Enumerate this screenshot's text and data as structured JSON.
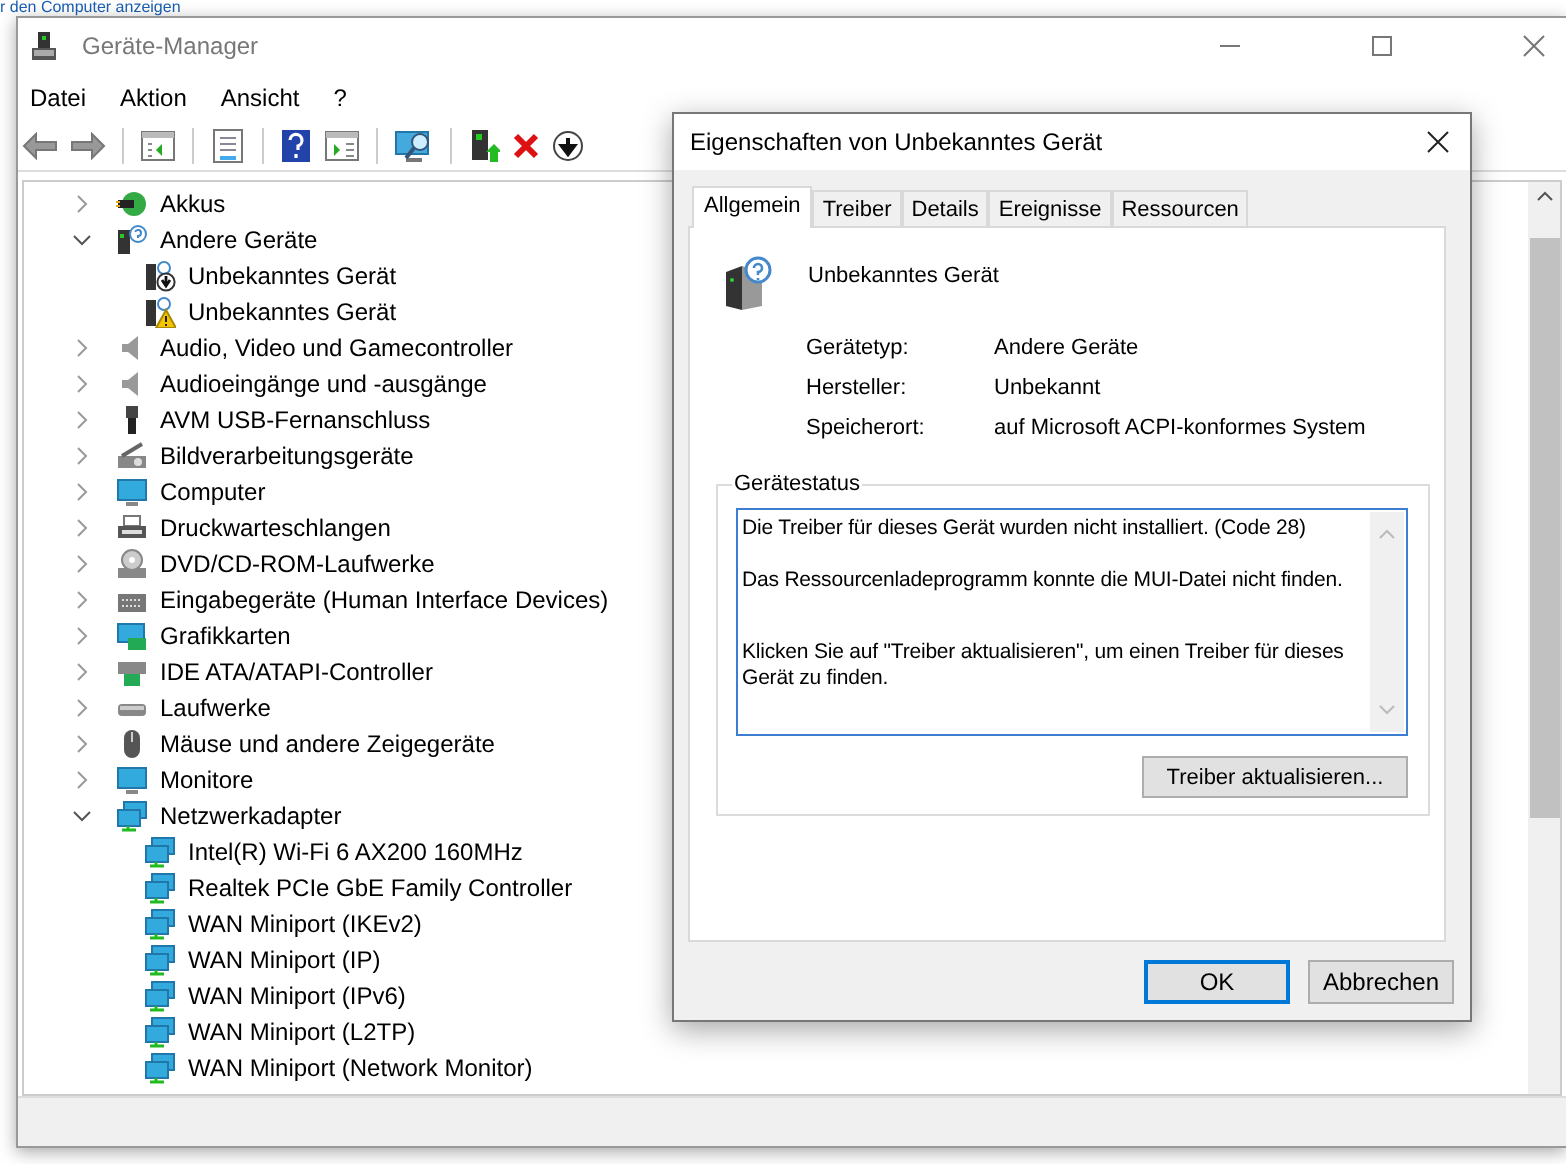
{
  "background_text": "r den Computer anzeigen",
  "window": {
    "title": "Geräte-Manager"
  },
  "menu": [
    "Datei",
    "Aktion",
    "Ansicht",
    "?"
  ],
  "tree": [
    {
      "label": "Akkus",
      "kind": "battery",
      "expanded": false
    },
    {
      "label": "Andere Geräte",
      "kind": "unknown",
      "expanded": true,
      "children": [
        {
          "label": "Unbekanntes Gerät",
          "kind": "unknown-disabled"
        },
        {
          "label": "Unbekanntes Gerät",
          "kind": "unknown-warning"
        }
      ]
    },
    {
      "label": "Audio, Video und Gamecontroller",
      "kind": "speaker",
      "expanded": false
    },
    {
      "label": "Audioeingänge und -ausgänge",
      "kind": "speaker",
      "expanded": false
    },
    {
      "label": "AVM USB-Fernanschluss",
      "kind": "usb",
      "expanded": false
    },
    {
      "label": "Bildverarbeitungsgeräte",
      "kind": "camera",
      "expanded": false
    },
    {
      "label": "Computer",
      "kind": "monitor",
      "expanded": false
    },
    {
      "label": "Druckwarteschlangen",
      "kind": "printer",
      "expanded": false
    },
    {
      "label": "DVD/CD-ROM-Laufwerke",
      "kind": "disc",
      "expanded": false
    },
    {
      "label": "Eingabegeräte (Human Interface Devices)",
      "kind": "keyboard",
      "expanded": false
    },
    {
      "label": "Grafikkarten",
      "kind": "graphics",
      "expanded": false
    },
    {
      "label": "IDE ATA/ATAPI-Controller",
      "kind": "chip",
      "expanded": false
    },
    {
      "label": "Laufwerke",
      "kind": "drive",
      "expanded": false
    },
    {
      "label": "Mäuse und andere Zeigegeräte",
      "kind": "mouse",
      "expanded": false
    },
    {
      "label": "Monitore",
      "kind": "monitor",
      "expanded": false
    },
    {
      "label": "Netzwerkadapter",
      "kind": "network",
      "expanded": true,
      "children": [
        {
          "label": "Intel(R) Wi-Fi 6 AX200 160MHz",
          "kind": "network"
        },
        {
          "label": "Realtek PCIe GbE Family Controller",
          "kind": "network"
        },
        {
          "label": "WAN Miniport (IKEv2)",
          "kind": "network"
        },
        {
          "label": "WAN Miniport (IP)",
          "kind": "network"
        },
        {
          "label": "WAN Miniport (IPv6)",
          "kind": "network"
        },
        {
          "label": "WAN Miniport (L2TP)",
          "kind": "network"
        },
        {
          "label": "WAN Miniport (Network Monitor)",
          "kind": "network"
        }
      ]
    }
  ],
  "dialog": {
    "title": "Eigenschaften von Unbekanntes Gerät",
    "tabs": [
      {
        "label": "Allgemein",
        "selected": true
      },
      {
        "label": "Treiber",
        "selected": false
      },
      {
        "label": "Details",
        "selected": false
      },
      {
        "label": "Ereignisse",
        "selected": false
      },
      {
        "label": "Ressourcen",
        "selected": false
      }
    ],
    "device_name": "Unbekanntes Gerät",
    "properties": [
      {
        "label": "Gerätetyp:",
        "value": "Andere Geräte"
      },
      {
        "label": "Hersteller:",
        "value": "Unbekannt"
      },
      {
        "label": "Speicherort:",
        "value": "auf Microsoft ACPI-konformes System"
      }
    ],
    "status": {
      "legend": "Gerätestatus",
      "paragraphs": [
        "Die Treiber für dieses Gerät wurden nicht installiert. (Code 28)",
        "Das Ressourcenladeprogramm konnte die MUI-Datei nicht finden.",
        "Klicken Sie auf \"Treiber aktualisieren\", um einen Treiber für dieses Gerät zu finden."
      ],
      "button": "Treiber aktualisieren..."
    },
    "buttons": [
      {
        "label": "OK",
        "default": true
      },
      {
        "label": "Abbrechen",
        "default": false
      }
    ]
  }
}
